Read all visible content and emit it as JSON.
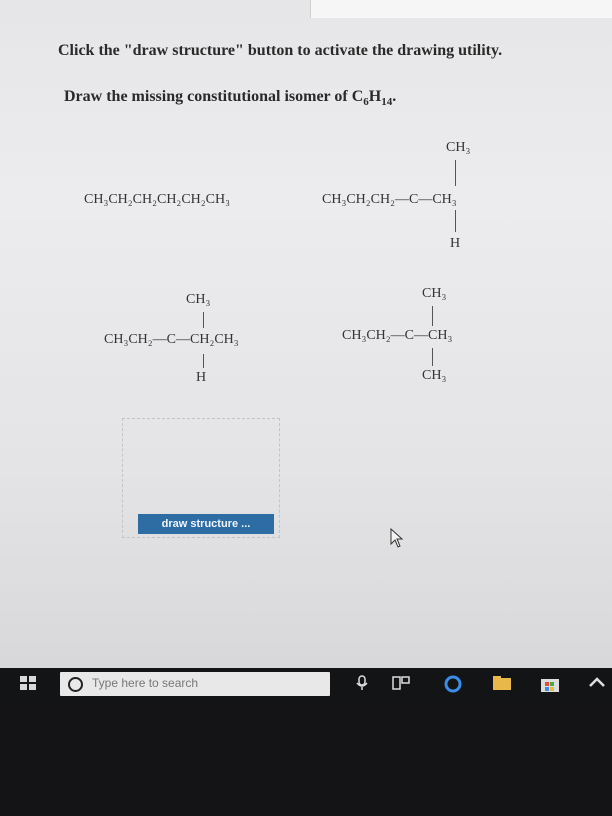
{
  "question": {
    "instruction": "Click the \"draw structure\" button to activate the drawing utility.",
    "prompt_prefix": "Draw the missing constitutional isomer of C",
    "prompt_c_sub": "6",
    "prompt_h": "H",
    "prompt_h_sub": "14",
    "prompt_suffix": "."
  },
  "structures": {
    "hexane": "CH₃CH₂CH₂CH₂CH₂CH₃",
    "methylpentane_2": {
      "top": "CH₃",
      "main": "CH₃CH₂CH₂—C—CH₃",
      "bottom": "H"
    },
    "methylpentane_3": {
      "top": "CH₃",
      "main": "CH₃CH₂—C—CH₂CH₃",
      "bottom": "H"
    },
    "dimethylbutane": {
      "top": "CH₃",
      "main": "CH₃CH₂—C—CH₃",
      "bottom": "CH₃"
    }
  },
  "draw_button_label": "draw structure ...",
  "taskbar": {
    "search_placeholder": "Type here to search"
  },
  "colors": {
    "button_blue": "#2e6da4",
    "taskbar": "#121416"
  },
  "icons": [
    "windows-start-icon",
    "search-circle-icon",
    "mouse-cursor-icon",
    "microphone-icon",
    "task-view-icon",
    "edge-browser-icon",
    "file-explorer-icon",
    "store-icon",
    "chevron-icon"
  ]
}
